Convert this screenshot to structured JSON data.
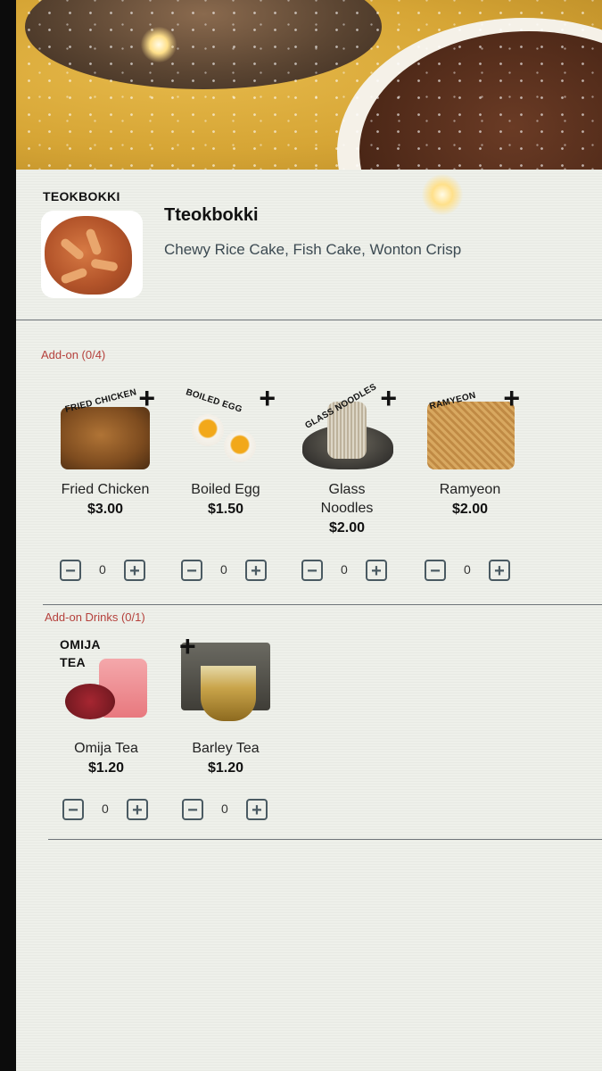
{
  "dish": {
    "image_label": "TEOKBOKKI",
    "title": "Tteokbokki",
    "description": "Chewy Rice Cake, Fish Cake, Wonton Crisp"
  },
  "addons": {
    "label": "Add-on (0/4)",
    "items": [
      {
        "name": "Fried Chicken",
        "price": "$3.00",
        "qty": "0",
        "image_label": "FRIED CHICKEN",
        "plus": "+",
        "minus_symbol": "−",
        "plus_symbol": "+"
      },
      {
        "name": "Boiled Egg",
        "price": "$1.50",
        "qty": "0",
        "image_label": "BOILED EGG",
        "plus": "+",
        "minus_symbol": "−",
        "plus_symbol": "+"
      },
      {
        "name": "Glass Noodles",
        "price": "$2.00",
        "qty": "0",
        "image_label": "GLASS NOODLES",
        "plus": "+",
        "minus_symbol": "−",
        "plus_symbol": "+"
      },
      {
        "name": "Ramyeon",
        "price": "$2.00",
        "qty": "0",
        "image_label": "RAMYEON",
        "plus": "+",
        "minus_symbol": "−",
        "plus_symbol": "+"
      }
    ]
  },
  "drinks": {
    "label": "Add-on Drinks (0/1)",
    "items": [
      {
        "name": "Omija Tea",
        "price": "$1.20",
        "qty": "0",
        "image_label": "OMIJA TEA",
        "minus_symbol": "−",
        "plus_symbol": "+"
      },
      {
        "name": "Barley Tea",
        "price": "$1.20",
        "qty": "0",
        "image_label": "+",
        "minus_symbol": "−",
        "plus_symbol": "+"
      }
    ]
  }
}
